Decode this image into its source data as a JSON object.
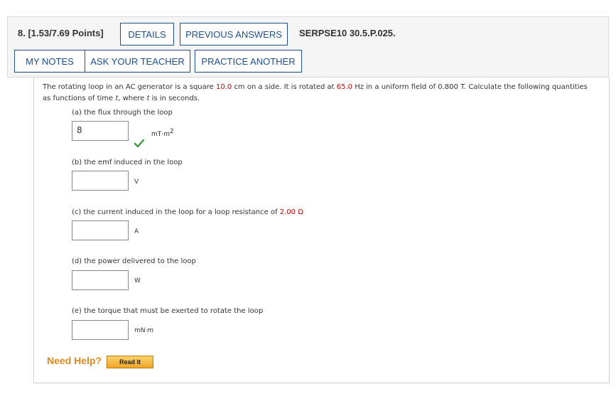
{
  "header": {
    "question_number": "8.",
    "points": "[1.53/7.69 Points]",
    "details_label": "DETAILS",
    "previous_answers_label": "PREVIOUS ANSWERS",
    "question_id": "SERPSE10 30.5.P.025.",
    "my_notes_label": "MY NOTES",
    "ask_teacher_label": "ASK YOUR TEACHER",
    "practice_another_label": "PRACTICE ANOTHER"
  },
  "problem": {
    "text_1": "The rotating loop in an AC generator is a square ",
    "side_value": "10.0",
    "text_2": " cm on a side. It is rotated at ",
    "freq_value": "65.0",
    "text_3": " Hz in a uniform field of 0.800 T. Calculate the following quantities as functions of time ",
    "t1": "t",
    "text_4": ", where ",
    "t2": "t",
    "text_5": " is in seconds."
  },
  "parts": {
    "a": {
      "label": "(a) the flux through the loop",
      "value": "8",
      "unit": "mT·m",
      "unit_sup": "2",
      "status": "correct"
    },
    "b": {
      "label": "(b) the emf induced in the loop",
      "value": "",
      "unit": "V"
    },
    "c": {
      "label_prefix": "(c) the current induced in the loop for a loop resistance of ",
      "resistance": "2.00 Ω",
      "value": "",
      "unit": "A"
    },
    "d": {
      "label": "(d) the power delivered to the loop",
      "value": "",
      "unit": "W"
    },
    "e": {
      "label": "(e) the torque that must be exerted to rotate the loop",
      "value": "",
      "unit": "mN·m"
    }
  },
  "help": {
    "need_help_label": "Need Help?",
    "read_it_label": "Read It"
  },
  "colors": {
    "button_border": "#1f4e8c",
    "highlight_red": "#c00000",
    "check_green": "#3a9a3a",
    "need_help_orange": "#e08a1e"
  }
}
